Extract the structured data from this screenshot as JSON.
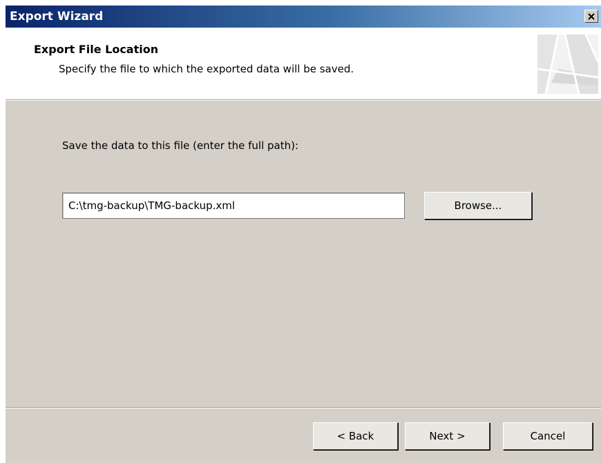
{
  "window": {
    "title": "Export Wizard",
    "close_icon": "close-x-icon"
  },
  "header": {
    "title": "Export File Location",
    "subtitle": "Specify the file to which the exported data will be saved.",
    "graphic_icon": "wizard-banner-graphic"
  },
  "body": {
    "prompt": "Save the data to this file (enter the full path):",
    "path_value": "C:\\tmg-backup\\TMG-backup.xml",
    "browse_label": "Browse..."
  },
  "footer": {
    "back_label": "< Back",
    "next_label": "Next >",
    "cancel_label": "Cancel"
  }
}
